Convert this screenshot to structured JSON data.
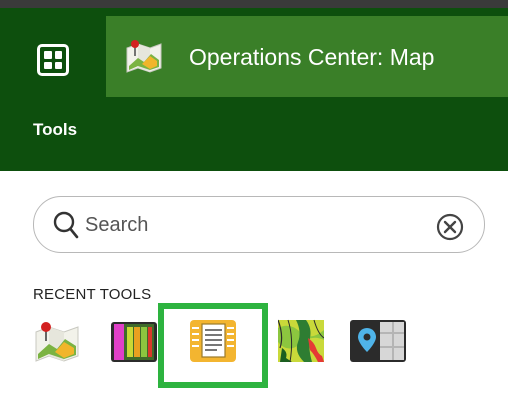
{
  "app": {
    "tab_title": "Operations Center: Map",
    "section_label": "Tools"
  },
  "search": {
    "placeholder": "Search",
    "value": ""
  },
  "recent_tools": {
    "heading": "RECENT TOOLS",
    "items": [
      {
        "icon": "map-icon"
      },
      {
        "icon": "field-analyzer-icon"
      },
      {
        "icon": "reports-icon",
        "selected": true
      },
      {
        "icon": "yield-map-icon"
      },
      {
        "icon": "equipment-location-icon"
      }
    ]
  },
  "colors": {
    "topstrip": "#3a3a3a",
    "header_bg": "#0d4f0d",
    "active_tab_bg": "#3a7f28",
    "selection_outline": "#2db33f"
  }
}
